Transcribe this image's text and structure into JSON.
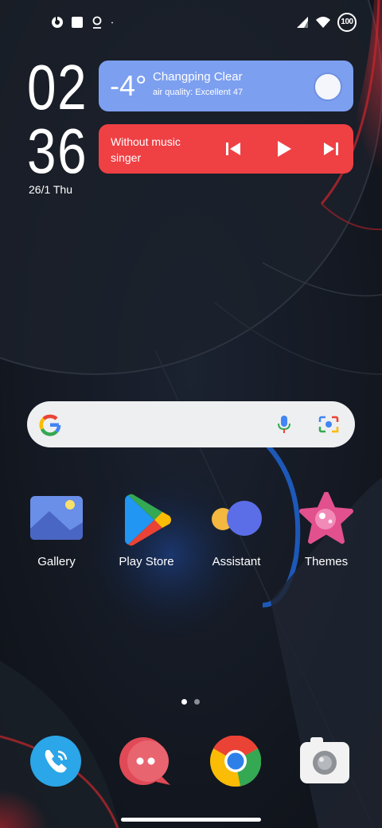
{
  "status_bar": {
    "left_icons": [
      "record-icon",
      "square-icon",
      "location-pin-icon",
      "dot-icon"
    ],
    "battery_level": "100"
  },
  "clock": {
    "hour": "02",
    "minute": "36",
    "date": "26/1  Thu"
  },
  "weather": {
    "temperature": "-4°",
    "location_condition": "Changping  Clear",
    "air_quality": "air quality: Excellent  47",
    "icon": "moon-icon"
  },
  "music": {
    "title_line1": "Without music",
    "title_line2": "singer",
    "controls": [
      "previous-icon",
      "play-icon",
      "next-icon"
    ]
  },
  "search": {
    "icons": [
      "google-g-icon",
      "mic-icon",
      "lens-icon"
    ]
  },
  "apps": [
    {
      "label": "Gallery",
      "icon": "gallery-icon"
    },
    {
      "label": "Play Store",
      "icon": "play-store-icon"
    },
    {
      "label": "Assistant",
      "icon": "assistant-icon"
    },
    {
      "label": "Themes",
      "icon": "themes-icon"
    }
  ],
  "pages": {
    "current": 1,
    "total": 2
  },
  "dock": [
    "phone-icon",
    "messages-icon",
    "chrome-icon",
    "camera-icon"
  ],
  "colors": {
    "weather_card": "#7c9ff0",
    "music_card": "#ef4044",
    "wallpaper_base": "#12161d",
    "wallpaper_accent_red": "#c4262c",
    "wallpaper_accent_blue": "#1e64d2"
  }
}
